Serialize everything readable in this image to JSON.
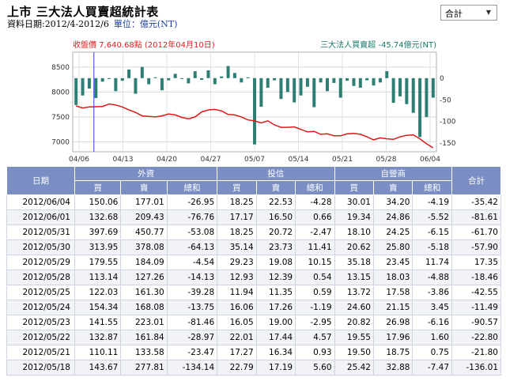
{
  "header": {
    "title": "上市 三大法人買賣超統計表",
    "date_range": "資料日期:2012/4-2012/6",
    "unit": "單位：億元(NT)"
  },
  "selector": {
    "selected": "合計"
  },
  "chart_data": {
    "type": "bar+line",
    "left_label": "收盤價 7,640.68點 (2012年04月10日)",
    "right_label": "三大法人買賣超 -45.74億元(NT)",
    "x_ticks": [
      "04/06",
      "04/13",
      "04/20",
      "04/27",
      "05/07",
      "05/14",
      "05/21",
      "05/28",
      "06/04"
    ],
    "left_axis": {
      "ticks": [
        8500,
        8000,
        7500,
        7000
      ],
      "min": 6800,
      "max": 8800
    },
    "right_axis": {
      "ticks": [
        0,
        -50,
        -100,
        -150
      ],
      "min": -170,
      "max": 60
    },
    "bars": [
      -62,
      -40,
      -24,
      -46,
      -8,
      -2,
      -30,
      -6,
      20,
      -36,
      26,
      -14,
      2,
      -28,
      -5,
      10,
      0,
      -12,
      16,
      -4,
      18,
      -14,
      4,
      28,
      12,
      -10,
      2,
      -153,
      -66,
      -22,
      -5,
      -48,
      -32,
      -56,
      -40,
      -20,
      -67,
      -10,
      -30,
      -11,
      -45,
      -6,
      -18,
      -22,
      -5,
      -17,
      -10,
      16,
      -57,
      -42,
      -60,
      -80,
      -136,
      -90,
      -45
    ],
    "close": [
      7720,
      7680,
      7700,
      7705,
      7710,
      7760,
      7740,
      7700,
      7640,
      7590,
      7520,
      7510,
      7500,
      7520,
      7560,
      7540,
      7490,
      7460,
      7500,
      7600,
      7640,
      7650,
      7620,
      7550,
      7540,
      7500,
      7440,
      7420,
      7380,
      7420,
      7340,
      7290,
      7290,
      7300,
      7250,
      7200,
      7210,
      7150,
      7160,
      7120,
      7120,
      7160,
      7170,
      7150,
      7100,
      7040,
      7080,
      7060,
      7050,
      7100,
      7130,
      7140,
      7060,
      6960,
      6880
    ],
    "grid": true,
    "marker_x": "04/10"
  },
  "table": {
    "groups": {
      "date": "日期",
      "foreign": "外資",
      "trust": "投信",
      "dealer": "自營商",
      "total": "合計"
    },
    "subheaders": [
      "買",
      "賣",
      "總和"
    ],
    "rows": [
      [
        "2012/06/04",
        "150.06",
        "177.01",
        "-26.95",
        "18.25",
        "22.53",
        "-4.28",
        "30.01",
        "34.20",
        "-4.19",
        "-35.42"
      ],
      [
        "2012/06/01",
        "132.68",
        "209.43",
        "-76.76",
        "17.17",
        "16.50",
        "0.66",
        "19.34",
        "24.86",
        "-5.52",
        "-81.61"
      ],
      [
        "2012/05/31",
        "397.69",
        "450.77",
        "-53.08",
        "18.25",
        "20.72",
        "-2.47",
        "18.10",
        "24.25",
        "-6.15",
        "-61.70"
      ],
      [
        "2012/05/30",
        "313.95",
        "378.08",
        "-64.13",
        "35.14",
        "23.73",
        "11.41",
        "20.62",
        "25.80",
        "-5.18",
        "-57.90"
      ],
      [
        "2012/05/29",
        "179.55",
        "184.09",
        "-4.54",
        "29.23",
        "19.08",
        "10.15",
        "35.18",
        "23.45",
        "11.74",
        "17.35"
      ],
      [
        "2012/05/28",
        "113.14",
        "127.26",
        "-14.13",
        "12.93",
        "12.39",
        "0.54",
        "13.15",
        "18.03",
        "-4.88",
        "-18.46"
      ],
      [
        "2012/05/25",
        "122.03",
        "161.30",
        "-39.28",
        "11.94",
        "11.35",
        "0.59",
        "13.72",
        "17.58",
        "-3.86",
        "-42.55"
      ],
      [
        "2012/05/24",
        "154.34",
        "168.08",
        "-13.75",
        "16.06",
        "17.26",
        "-1.19",
        "24.60",
        "21.15",
        "3.45",
        "-11.49"
      ],
      [
        "2012/05/23",
        "141.55",
        "223.01",
        "-81.46",
        "16.05",
        "19.00",
        "-2.95",
        "20.82",
        "26.98",
        "-6.16",
        "-90.57"
      ],
      [
        "2012/05/22",
        "132.87",
        "161.84",
        "-28.97",
        "22.01",
        "17.44",
        "4.57",
        "19.55",
        "17.96",
        "1.60",
        "-22.80"
      ],
      [
        "2012/05/21",
        "110.11",
        "133.58",
        "-23.47",
        "17.27",
        "16.34",
        "0.93",
        "19.50",
        "18.75",
        "0.75",
        "-21.80"
      ],
      [
        "2012/05/18",
        "143.67",
        "277.81",
        "-134.14",
        "22.79",
        "17.19",
        "5.60",
        "25.42",
        "32.88",
        "-7.47",
        "-136.01"
      ]
    ]
  }
}
